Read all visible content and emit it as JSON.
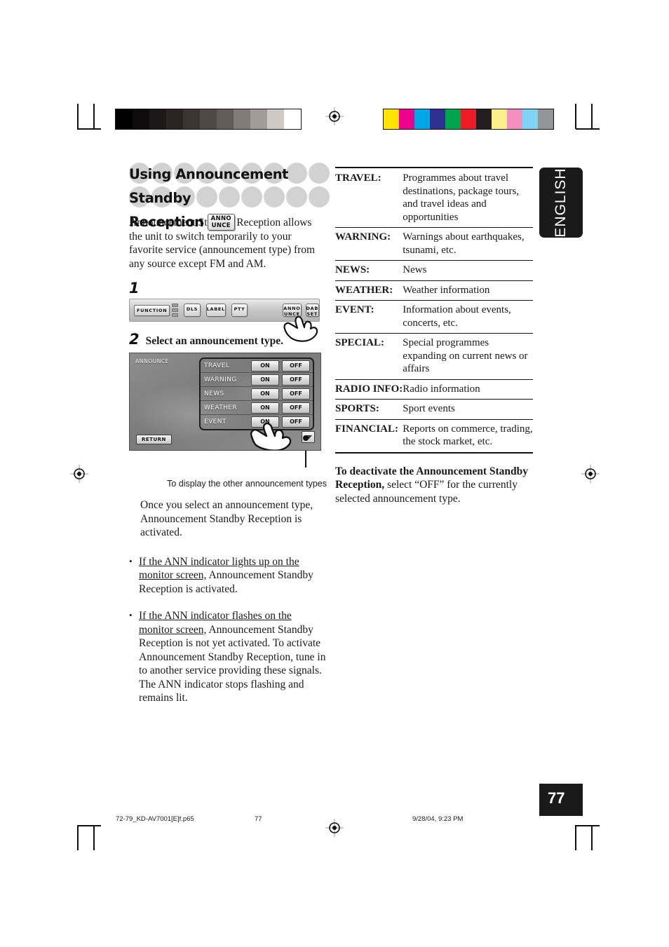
{
  "heading": {
    "line1": "Using Announcement Standby",
    "line2": "Reception",
    "button_line1": "ANNO",
    "button_line2": "UNCE"
  },
  "intro": "Announcement Standby Reception allows the unit to switch temporarily to your favorite service (announcement type) from any source except FM and AM.",
  "steps": {
    "one_num": "1",
    "two_num": "2",
    "two_title": "Select an announcement type."
  },
  "panel_buttons": {
    "function": "FUNCTION",
    "dls": "DLS",
    "label": "LABEL",
    "pty": "PTY",
    "anno_l1": "ANNO",
    "anno_l2": "UNCE",
    "dab_l1": "DAB",
    "dab_l2": "SET"
  },
  "monitor": {
    "title": "ANNOUNCE",
    "return_label": "RETURN",
    "on_label": "ON",
    "off_label": "OFF",
    "rows": [
      {
        "name": "TRAVEL"
      },
      {
        "name": "WARNING"
      },
      {
        "name": "NEWS"
      },
      {
        "name": "WEATHER"
      },
      {
        "name": "EVENT"
      }
    ]
  },
  "caption": "To display the other announcement types",
  "after_note": "Once you select an announcement type, Announcement Standby Reception is activated.",
  "bullets": [
    {
      "underlined": "If the ANN indicator lights up on the monitor screen,",
      "rest": " Announcement Standby Reception is activated."
    },
    {
      "underlined": "If the ANN indicator flashes on the monitor screen,",
      "rest": " Announcement Standby Reception is not yet activated. To activate Announcement Standby Reception, tune in to another service providing these signals. The ANN indicator stops flashing and remains lit."
    }
  ],
  "table": {
    "rows": [
      {
        "term": "TRAVEL:",
        "desc": "Programmes about travel destinations, package tours, and travel ideas and opportunities"
      },
      {
        "term": "WARNING:",
        "desc": "Warnings about earthquakes, tsunami, etc."
      },
      {
        "term": "NEWS:",
        "desc": "News"
      },
      {
        "term": "WEATHER:",
        "desc": "Weather information"
      },
      {
        "term": "EVENT:",
        "desc": "Information about events, concerts, etc."
      },
      {
        "term": "SPECIAL:",
        "desc": "Special programmes expanding on current news or affairs"
      },
      {
        "term": "RADIO INFO:",
        "desc": "Radio information"
      },
      {
        "term": "SPORTS:",
        "desc": "Sport events"
      },
      {
        "term": "FINANCIAL:",
        "desc": "Reports on commerce, trading, the stock market, etc."
      }
    ]
  },
  "deactivate": {
    "bold": "To deactivate the Announcement Standby Reception,",
    "rest": " select “OFF” for the currently selected announcement type."
  },
  "language_tab": "ENGLISH",
  "page_number": "77",
  "footer": {
    "file": "72-79_KD-AV7001[E]f.p65",
    "page": "77",
    "date": "9/28/04, 9:23 PM"
  },
  "calibration": {
    "gray_swatches": [
      "#000000",
      "#0e0c0c",
      "#1b1817",
      "#2a2523",
      "#3b3532",
      "#4f4845",
      "#645c58",
      "#837b77",
      "#a39b97",
      "#cfc9c5",
      "#ffffff"
    ],
    "color_swatches": [
      "#ffe600",
      "#ec008c",
      "#00a7e6",
      "#2e3192",
      "#00a551",
      "#ed1c24",
      "#231f20",
      "#fdee8c",
      "#f58fc2",
      "#7fd4f5",
      "#939598"
    ]
  }
}
